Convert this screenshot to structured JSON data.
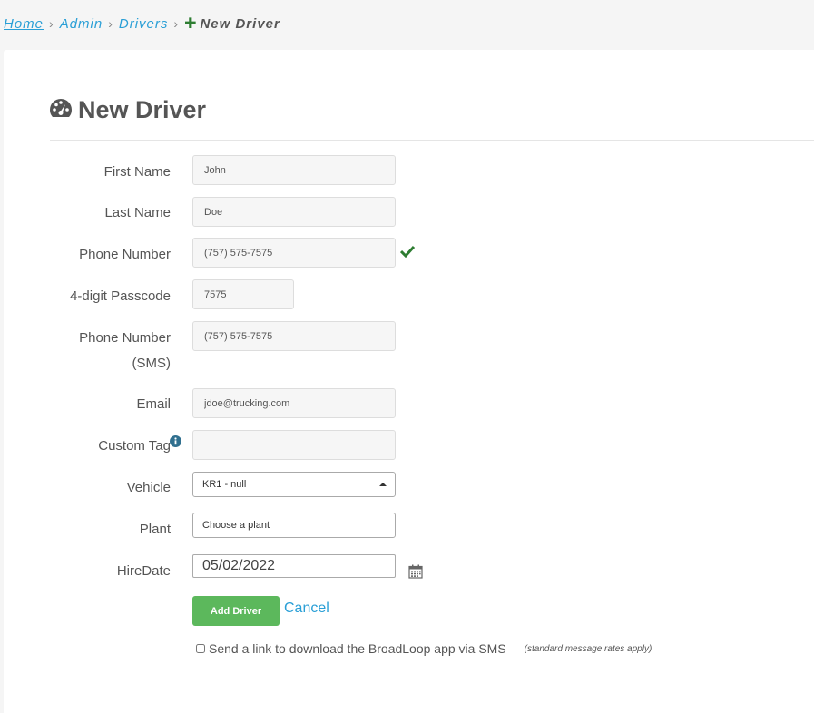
{
  "breadcrumb": {
    "home": "Home",
    "admin": "Admin",
    "drivers": "Drivers",
    "current": "New Driver",
    "separator": "›",
    "plus": "✚"
  },
  "page": {
    "title": "New Driver"
  },
  "form": {
    "first_name": {
      "label": "First Name",
      "value": "John"
    },
    "last_name": {
      "label": "Last Name",
      "value": "Doe"
    },
    "phone": {
      "label": "Phone Number",
      "value": "(757) 575-7575"
    },
    "passcode": {
      "label": "4-digit Passcode",
      "value": "7575"
    },
    "phone_sms": {
      "label_line1": "Phone Number",
      "label_line2": "(SMS)",
      "value": "(757) 575-7575"
    },
    "email": {
      "label": "Email",
      "value": "jdoe@trucking.com"
    },
    "custom_tag": {
      "label": "Custom Tag",
      "value": ""
    },
    "vehicle": {
      "label": "Vehicle",
      "value": "KR1 - null"
    },
    "plant": {
      "label": "Plant",
      "value": "Choose a plant"
    },
    "hire_date": {
      "label": "HireDate",
      "value": "05/02/2022"
    }
  },
  "actions": {
    "add_label": "Add Driver",
    "cancel_label": "Cancel"
  },
  "sms_option": {
    "label": "Send a link to download the BroadLoop app via SMS",
    "note": "(standard message rates apply)",
    "checked": false
  },
  "colors": {
    "accent": "#2a9fd6",
    "success": "#5cb85c",
    "check": "#2e7d32",
    "info": "#31708f"
  },
  "icons": [
    "dashboard-icon",
    "check-icon",
    "info-icon",
    "calendar-icon",
    "plus-icon"
  ]
}
